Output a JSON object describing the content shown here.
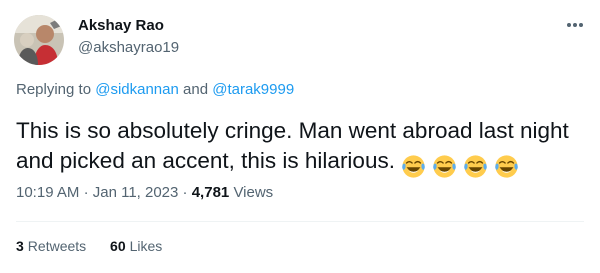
{
  "author": {
    "name": "Akshay Rao",
    "handle": "@akshayrao19"
  },
  "reply": {
    "prefix": "Replying to",
    "mention_1": "@sidkannan",
    "joiner": "and",
    "mention_2": "@tarak9999"
  },
  "tweet": {
    "text": "This is so absolutely cringe. Man went abroad last night and picked an accent, this is hilarious.",
    "emoji_icon": "face-with-tears-of-joy-icon",
    "emoji_count": 4
  },
  "meta": {
    "time": "10:19 AM",
    "separator": "·",
    "date": "Jan 11, 2023",
    "views_count": "4,781",
    "views_label": "Views"
  },
  "stats": {
    "retweets_count": "3",
    "retweets_label": "Retweets",
    "likes_count": "60",
    "likes_label": "Likes"
  },
  "colors": {
    "text_primary": "#0f1419",
    "text_secondary": "#536471",
    "link": "#1d9bf0",
    "divider": "#eff3f4"
  }
}
